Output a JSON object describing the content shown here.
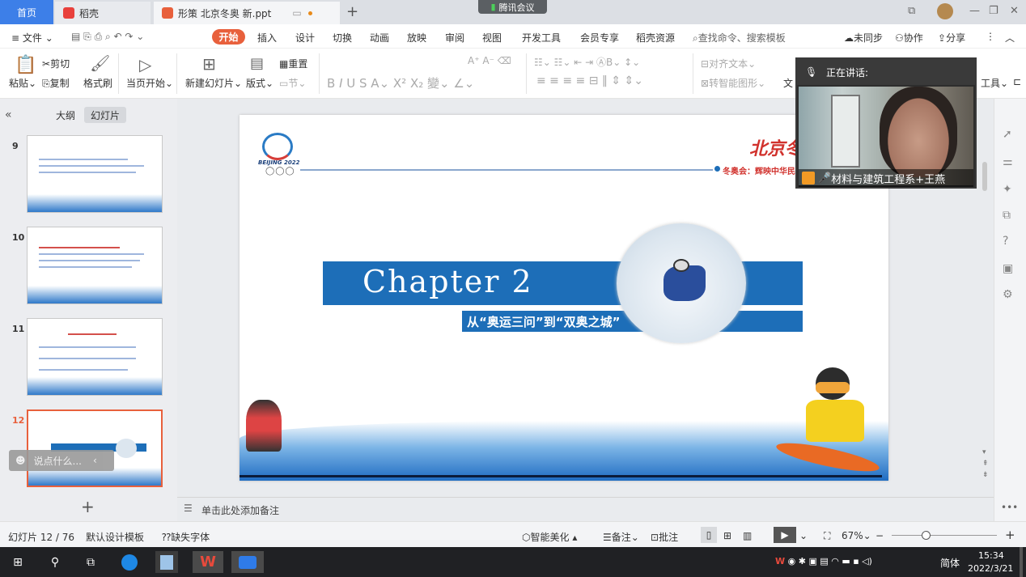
{
  "tabs": {
    "home": "首页",
    "doc1": "稻壳",
    "doc2": "形策 北京冬奥 新.ppt",
    "meeting": "腾讯会议"
  },
  "menu": {
    "file": "文件",
    "items": [
      "开始",
      "插入",
      "设计",
      "切换",
      "动画",
      "放映",
      "审阅",
      "视图",
      "开发工具",
      "会员专享",
      "稻壳资源"
    ],
    "search": "查找命令、搜索模板",
    "sync": "未同步",
    "collab": "协作",
    "share": "分享"
  },
  "ribbon": {
    "paste": "粘贴",
    "cut": "剪切",
    "copy": "复制",
    "format_painter": "格式刷",
    "from_current": "当页开始",
    "new_slide": "新建幻灯片",
    "layout": "版式",
    "section": "节",
    "reset": "重置",
    "align_text": "对齐文本",
    "smart_art": "转智能图形",
    "text_label": "文",
    "tools": "工具"
  },
  "left": {
    "outline": "大纲",
    "slides": "幻灯片",
    "thumbs": [
      {
        "num": "9"
      },
      {
        "num": "10"
      },
      {
        "num": "11"
      },
      {
        "num": "12"
      }
    ],
    "chat_placeholder": "说点什么..."
  },
  "slide": {
    "chapter": "Chapter 2",
    "subtitle": "从“奥运三问”到“双奥之城”",
    "beijing": "BEIJING 2022",
    "header_text": "冬奥会：辉映中华民",
    "logo_right": "北京冬"
  },
  "notes": {
    "placeholder": "单击此处添加备注"
  },
  "video": {
    "speaking": "正在讲话:",
    "name": "材料与建筑工程系+王燕"
  },
  "status": {
    "slide_count": "幻灯片 12 / 76",
    "template": "默认设计模板",
    "missing_font": "缺失字体",
    "beautify": "智能美化",
    "notes": "备注",
    "comment": "批注",
    "zoom": "67%"
  },
  "taskbar": {
    "time": "15:34",
    "date": "2022/3/21",
    "ime": "简体"
  }
}
